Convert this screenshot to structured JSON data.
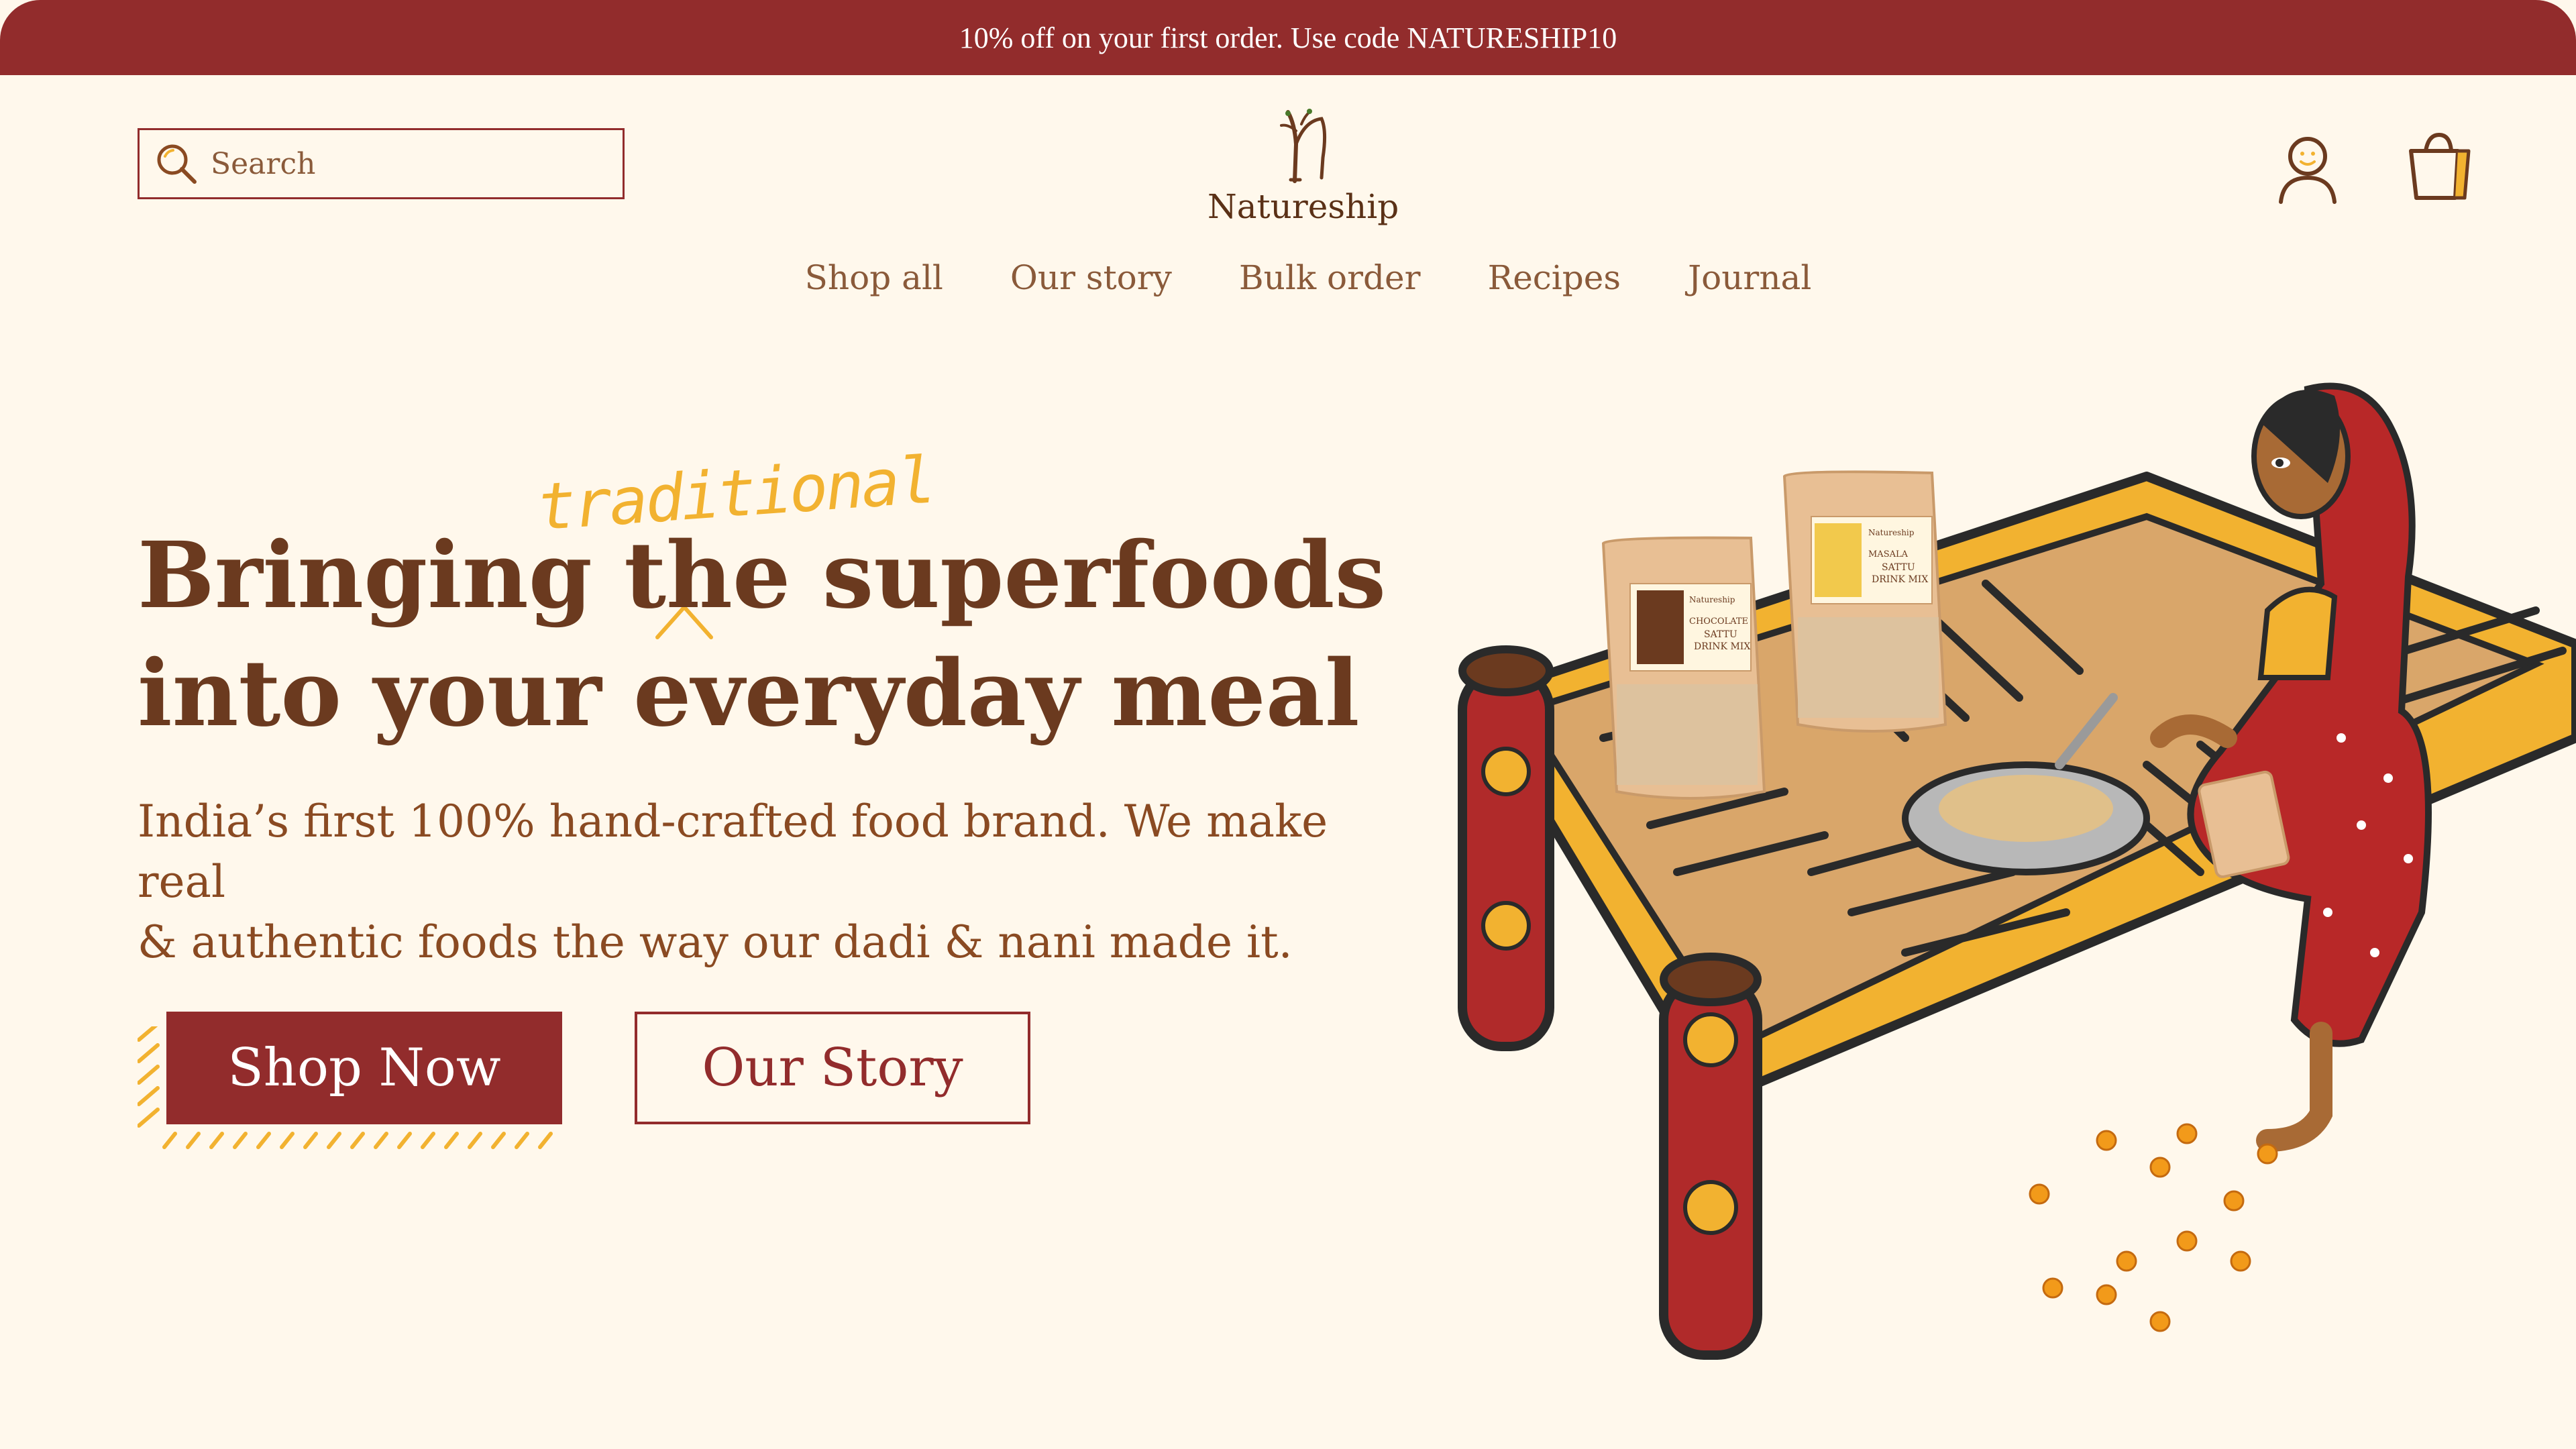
{
  "promo": {
    "text": "10% off on your first order. Use code NATURESHIP10"
  },
  "search": {
    "placeholder": "Search"
  },
  "brand": {
    "name": "Natureship"
  },
  "nav": {
    "items": [
      {
        "label": "Shop all"
      },
      {
        "label": "Our story"
      },
      {
        "label": "Bulk order"
      },
      {
        "label": "Recipes"
      },
      {
        "label": "Journal"
      }
    ]
  },
  "hero": {
    "accent_word": "traditional",
    "headline_line1": "Bringing the superfoods",
    "headline_line2": "into your everyday meal",
    "subtext_line1": "India’s first 100% hand-crafted food brand. We make real",
    "subtext_line2": "& authentic foods the way our dadi & nani made it.",
    "primary_button": "Shop Now",
    "secondary_button": "Our Story"
  },
  "products": [
    {
      "brand": "Natureship",
      "flavor": "CHOCOLATE",
      "name_line1": "SATTU",
      "name_line2": "DRINK MIX"
    },
    {
      "brand": "Natureship",
      "flavor": "MASALA",
      "name_line1": "SATTU",
      "name_line2": "DRINK MIX"
    }
  ],
  "icons": {
    "search": "search-icon",
    "logo": "tree-logo-icon",
    "account": "user-icon",
    "cart": "shopping-bag-icon"
  },
  "colors": {
    "brand_red": "#922c2c",
    "background": "#fff8ec",
    "text_brown": "#6b3a1f",
    "accent_yellow": "#f2b230"
  }
}
